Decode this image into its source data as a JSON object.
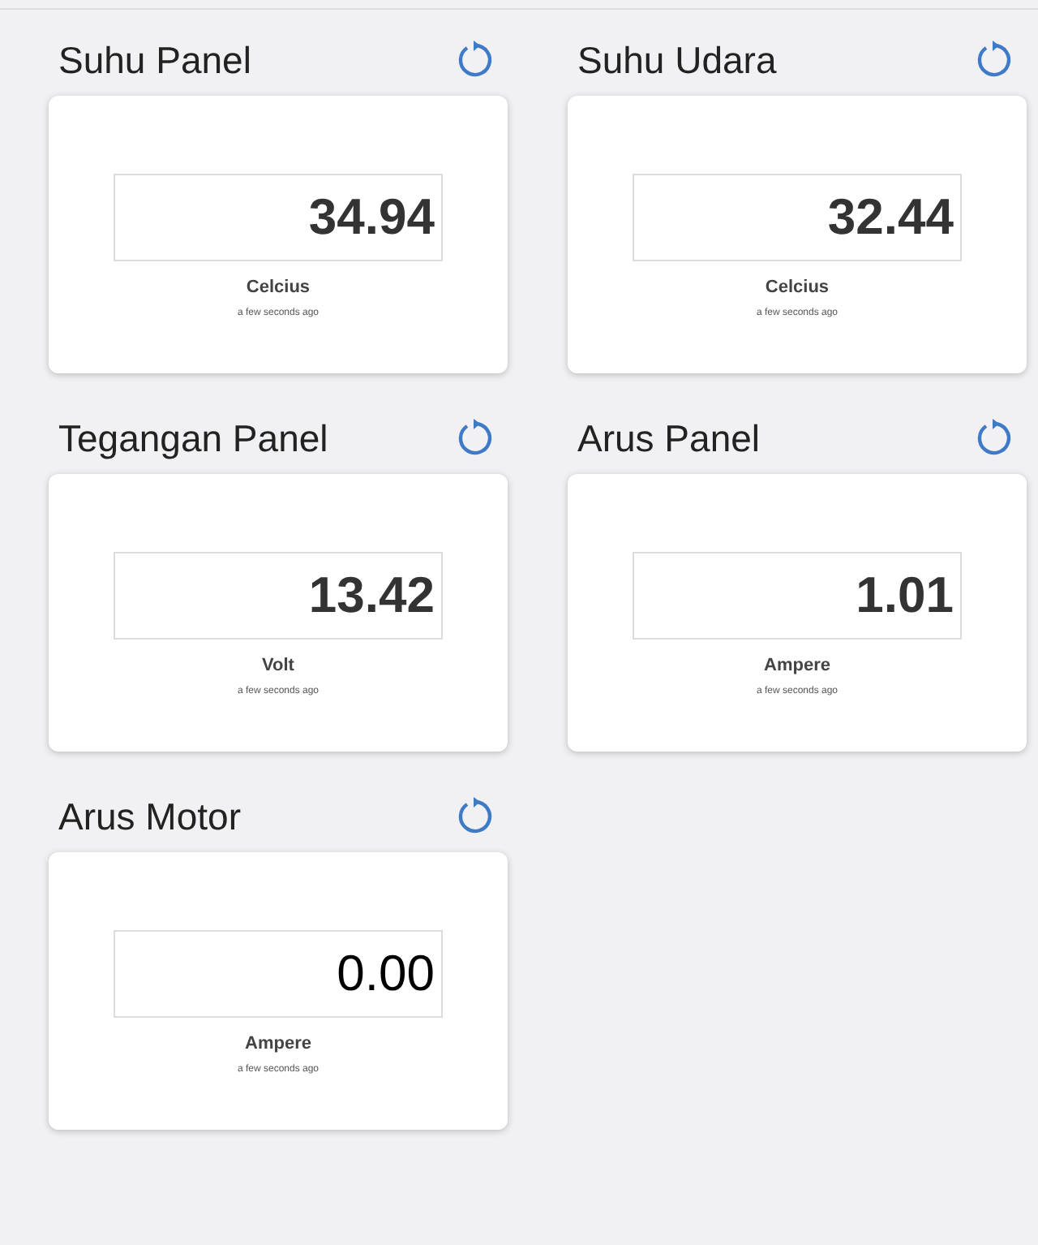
{
  "cards": [
    {
      "title": "Suhu Panel",
      "value": "34.94",
      "value_bold": true,
      "unit": "Celcius",
      "updated": "a few seconds ago"
    },
    {
      "title": "Suhu Udara",
      "value": "32.44",
      "value_bold": true,
      "unit": "Celcius",
      "updated": "a few seconds ago"
    },
    {
      "title": "Tegangan Panel",
      "value": "13.42",
      "value_bold": true,
      "unit": "Volt",
      "updated": "a few seconds ago"
    },
    {
      "title": "Arus Panel",
      "value": "1.01",
      "value_bold": true,
      "unit": "Ampere",
      "updated": "a few seconds ago"
    },
    {
      "title": "Arus Motor",
      "value": "0.00",
      "value_bold": false,
      "unit": "Ampere",
      "updated": "a few seconds ago"
    }
  ]
}
